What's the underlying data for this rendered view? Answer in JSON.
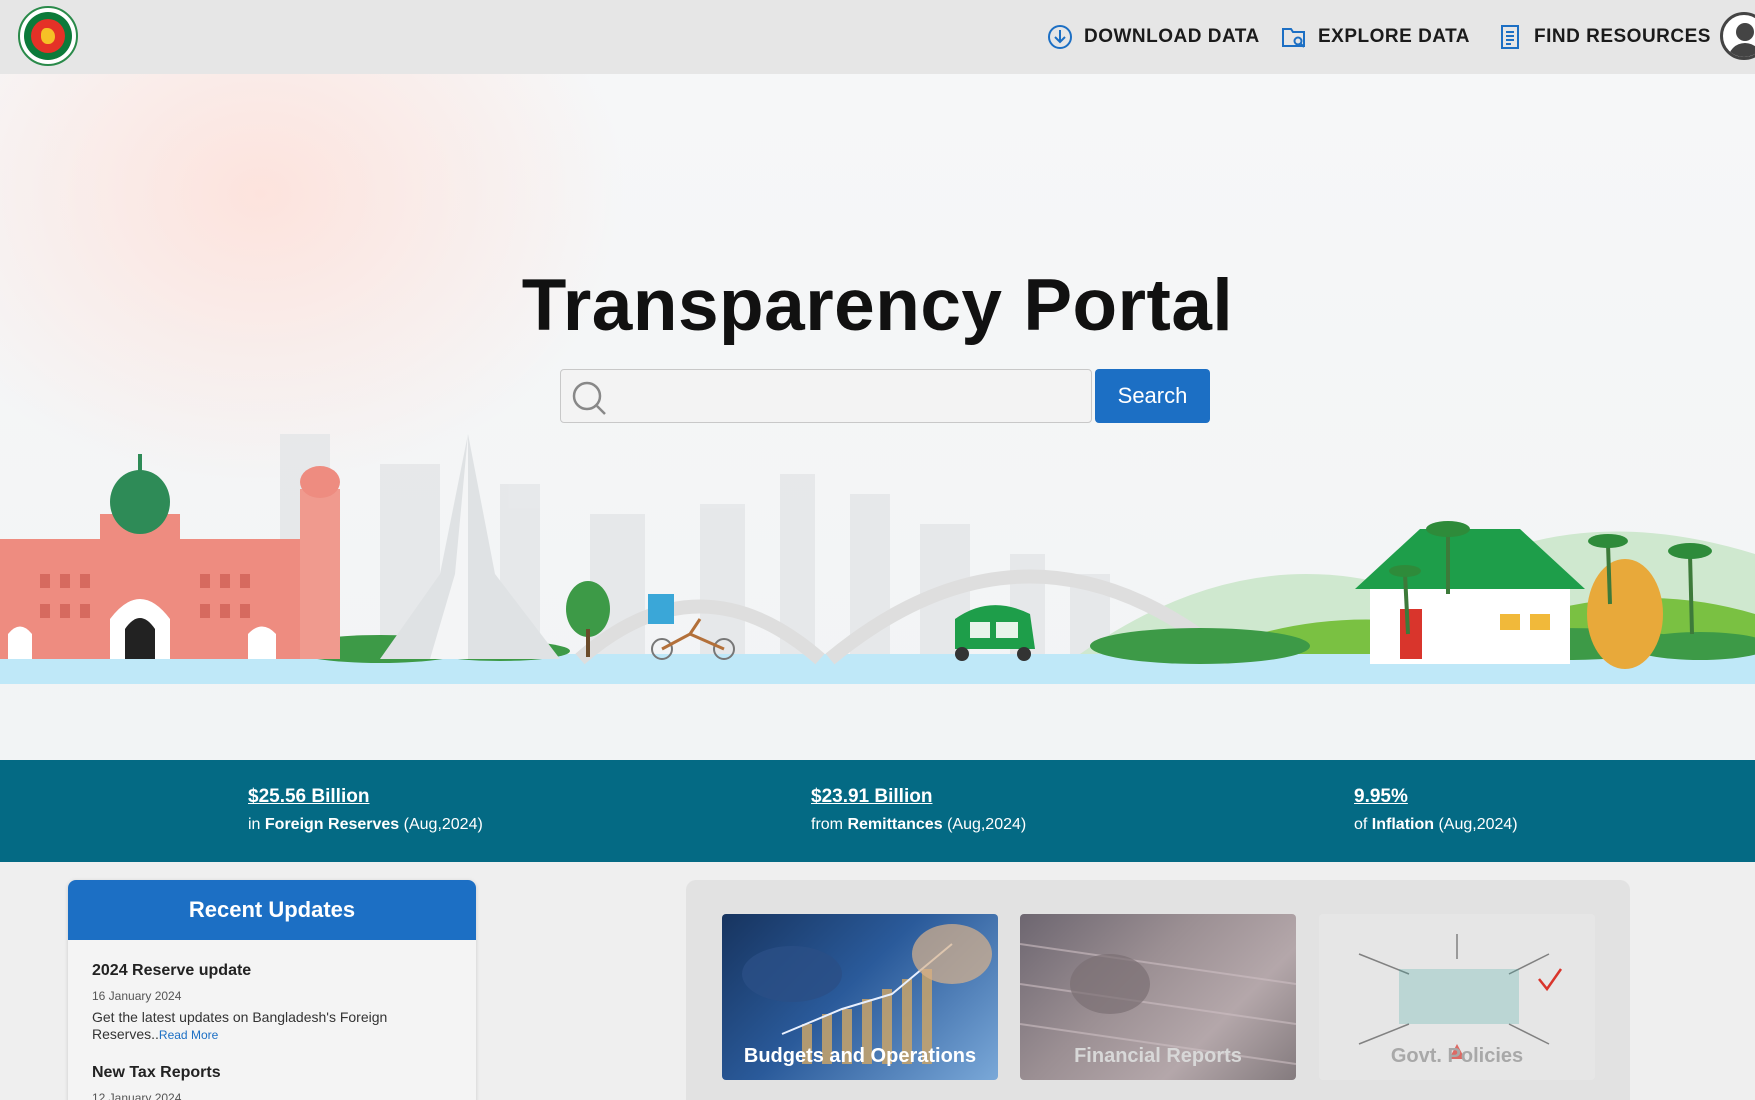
{
  "header": {
    "nav": [
      {
        "label": "DOWNLOAD DATA",
        "icon": "download-icon"
      },
      {
        "label": "EXPLORE DATA",
        "icon": "folder-search-icon"
      },
      {
        "label": "FIND RESOURCES",
        "icon": "document-icon"
      }
    ],
    "logo_icon": "government-seal-logo",
    "avatar_icon": "user-avatar-icon"
  },
  "hero": {
    "title": "Transparency Portal",
    "search_value": "",
    "search_button": "Search"
  },
  "stats": [
    {
      "value": "$25.56 Billion",
      "prefix": "in",
      "metric": "Foreign Reserves",
      "period": "(Aug,2024)"
    },
    {
      "value": "$23.91 Billion",
      "prefix": "from",
      "metric": "Remittances",
      "period": "(Aug,2024)"
    },
    {
      "value": "9.95%",
      "prefix": "of",
      "metric": "Inflation",
      "period": "(Aug,2024)"
    }
  ],
  "updates": {
    "heading": "Recent Updates",
    "items": [
      {
        "title": "2024 Reserve update",
        "date": "16 January 2024",
        "body": "Get the latest updates on Bangladesh's Foreign Reserves..",
        "link": "Read More"
      },
      {
        "title": "New Tax Reports",
        "date": "12 January 2024"
      }
    ]
  },
  "cards": [
    {
      "label": "Budgets and Operations"
    },
    {
      "label": "Financial Reports"
    },
    {
      "label": "Govt. Policies"
    }
  ],
  "colors": {
    "accent_blue": "#1c6fc4",
    "stats_band": "#046a84",
    "header_bg": "#e6e6e6"
  }
}
